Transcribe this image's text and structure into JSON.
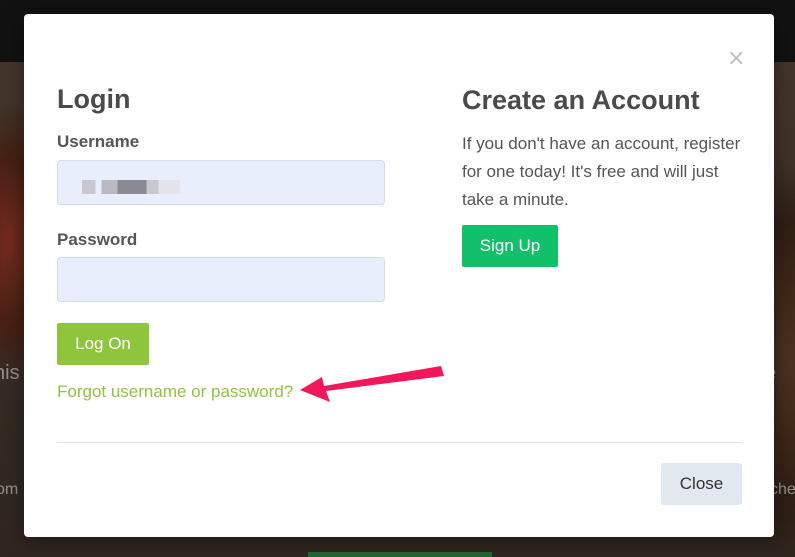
{
  "background": {
    "left_fragment_1": "nis",
    "right_fragment_1": "e",
    "left_fragment_2": "om",
    "right_fragment_2": "che"
  },
  "modal": {
    "close_symbol": "×",
    "login": {
      "title": "Login",
      "username_label": "Username",
      "username_value": "",
      "password_label": "Password",
      "password_value": "",
      "logon_button": "Log On",
      "forgot_link": "Forgot username or password?"
    },
    "create": {
      "title": "Create an Account",
      "description": "If you don't have an account, register for one today! It's free and will just take a minute.",
      "signup_button": "Sign Up"
    },
    "footer": {
      "close_button": "Close"
    }
  },
  "colors": {
    "logon_green": "#8fc43d",
    "signup_green": "#12c06a",
    "annotation_arrow": "#f0185a"
  },
  "icons": {
    "close": "close-icon",
    "annotation": "annotation-arrow"
  }
}
